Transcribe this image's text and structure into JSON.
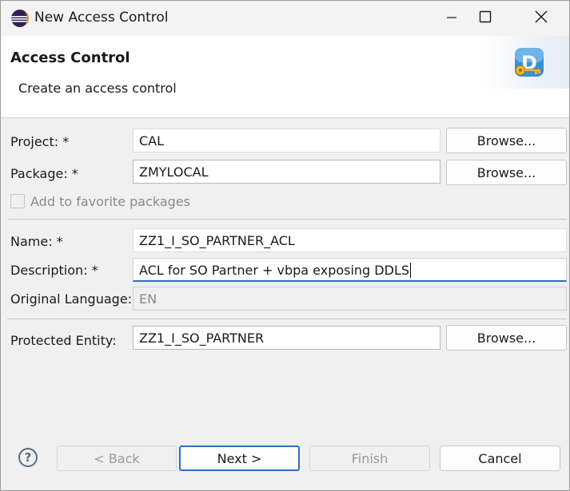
{
  "window": {
    "title": "New Access Control"
  },
  "header": {
    "title": "Access Control",
    "subtitle": "Create an access control"
  },
  "form": {
    "project": {
      "label": "Project: *",
      "value": "CAL",
      "browse": "Browse..."
    },
    "package": {
      "label": "Package: *",
      "value": "ZMYLOCAL",
      "browse": "Browse..."
    },
    "favorite": {
      "label": "Add to favorite packages",
      "checked": false
    },
    "name": {
      "label": "Name: *",
      "value": "ZZ1_I_SO_PARTNER_ACL"
    },
    "description": {
      "label": "Description: *",
      "value": "ACL for SO Partner + vbpa exposing DDLS"
    },
    "language": {
      "label": "Original Language:",
      "value": "EN"
    },
    "entity": {
      "label": "Protected Entity:",
      "value": "ZZ1_I_SO_PARTNER",
      "browse": "Browse..."
    }
  },
  "footer": {
    "help": "?",
    "back": "< Back",
    "next": "Next >",
    "finish": "Finish",
    "cancel": "Cancel"
  },
  "icons": {
    "app": "eclipse-icon",
    "wizard": "access-key-icon",
    "minimize": "minimize-icon",
    "maximize": "maximize-icon",
    "close": "close-icon"
  },
  "colors": {
    "accent": "#2a6fc4",
    "window_bg": "#f0f0f0",
    "header_bg": "#ffffff"
  }
}
